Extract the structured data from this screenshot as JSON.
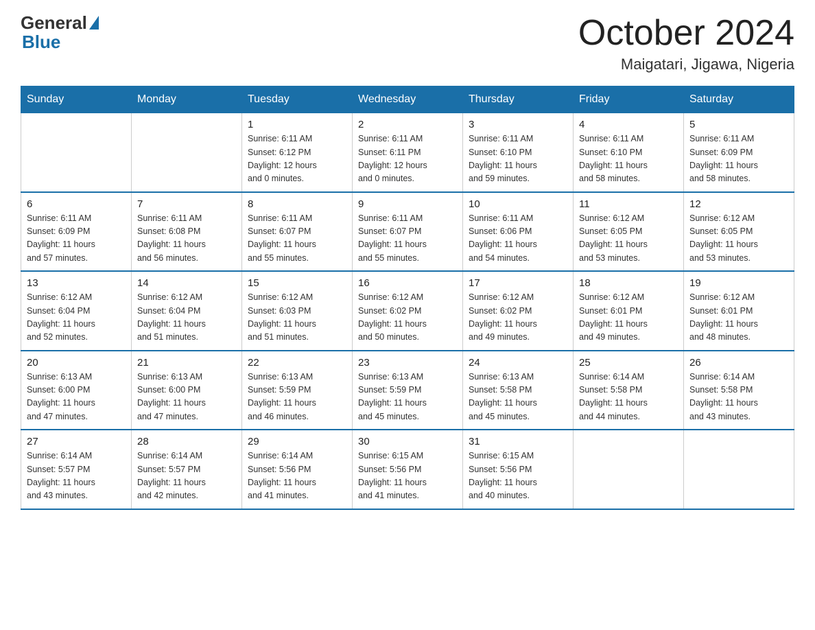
{
  "header": {
    "logo_general": "General",
    "logo_blue": "Blue",
    "title": "October 2024",
    "subtitle": "Maigatari, Jigawa, Nigeria"
  },
  "columns": [
    "Sunday",
    "Monday",
    "Tuesday",
    "Wednesday",
    "Thursday",
    "Friday",
    "Saturday"
  ],
  "weeks": [
    [
      {
        "day": "",
        "info": ""
      },
      {
        "day": "",
        "info": ""
      },
      {
        "day": "1",
        "info": "Sunrise: 6:11 AM\nSunset: 6:12 PM\nDaylight: 12 hours\nand 0 minutes."
      },
      {
        "day": "2",
        "info": "Sunrise: 6:11 AM\nSunset: 6:11 PM\nDaylight: 12 hours\nand 0 minutes."
      },
      {
        "day": "3",
        "info": "Sunrise: 6:11 AM\nSunset: 6:10 PM\nDaylight: 11 hours\nand 59 minutes."
      },
      {
        "day": "4",
        "info": "Sunrise: 6:11 AM\nSunset: 6:10 PM\nDaylight: 11 hours\nand 58 minutes."
      },
      {
        "day": "5",
        "info": "Sunrise: 6:11 AM\nSunset: 6:09 PM\nDaylight: 11 hours\nand 58 minutes."
      }
    ],
    [
      {
        "day": "6",
        "info": "Sunrise: 6:11 AM\nSunset: 6:09 PM\nDaylight: 11 hours\nand 57 minutes."
      },
      {
        "day": "7",
        "info": "Sunrise: 6:11 AM\nSunset: 6:08 PM\nDaylight: 11 hours\nand 56 minutes."
      },
      {
        "day": "8",
        "info": "Sunrise: 6:11 AM\nSunset: 6:07 PM\nDaylight: 11 hours\nand 55 minutes."
      },
      {
        "day": "9",
        "info": "Sunrise: 6:11 AM\nSunset: 6:07 PM\nDaylight: 11 hours\nand 55 minutes."
      },
      {
        "day": "10",
        "info": "Sunrise: 6:11 AM\nSunset: 6:06 PM\nDaylight: 11 hours\nand 54 minutes."
      },
      {
        "day": "11",
        "info": "Sunrise: 6:12 AM\nSunset: 6:05 PM\nDaylight: 11 hours\nand 53 minutes."
      },
      {
        "day": "12",
        "info": "Sunrise: 6:12 AM\nSunset: 6:05 PM\nDaylight: 11 hours\nand 53 minutes."
      }
    ],
    [
      {
        "day": "13",
        "info": "Sunrise: 6:12 AM\nSunset: 6:04 PM\nDaylight: 11 hours\nand 52 minutes."
      },
      {
        "day": "14",
        "info": "Sunrise: 6:12 AM\nSunset: 6:04 PM\nDaylight: 11 hours\nand 51 minutes."
      },
      {
        "day": "15",
        "info": "Sunrise: 6:12 AM\nSunset: 6:03 PM\nDaylight: 11 hours\nand 51 minutes."
      },
      {
        "day": "16",
        "info": "Sunrise: 6:12 AM\nSunset: 6:02 PM\nDaylight: 11 hours\nand 50 minutes."
      },
      {
        "day": "17",
        "info": "Sunrise: 6:12 AM\nSunset: 6:02 PM\nDaylight: 11 hours\nand 49 minutes."
      },
      {
        "day": "18",
        "info": "Sunrise: 6:12 AM\nSunset: 6:01 PM\nDaylight: 11 hours\nand 49 minutes."
      },
      {
        "day": "19",
        "info": "Sunrise: 6:12 AM\nSunset: 6:01 PM\nDaylight: 11 hours\nand 48 minutes."
      }
    ],
    [
      {
        "day": "20",
        "info": "Sunrise: 6:13 AM\nSunset: 6:00 PM\nDaylight: 11 hours\nand 47 minutes."
      },
      {
        "day": "21",
        "info": "Sunrise: 6:13 AM\nSunset: 6:00 PM\nDaylight: 11 hours\nand 47 minutes."
      },
      {
        "day": "22",
        "info": "Sunrise: 6:13 AM\nSunset: 5:59 PM\nDaylight: 11 hours\nand 46 minutes."
      },
      {
        "day": "23",
        "info": "Sunrise: 6:13 AM\nSunset: 5:59 PM\nDaylight: 11 hours\nand 45 minutes."
      },
      {
        "day": "24",
        "info": "Sunrise: 6:13 AM\nSunset: 5:58 PM\nDaylight: 11 hours\nand 45 minutes."
      },
      {
        "day": "25",
        "info": "Sunrise: 6:14 AM\nSunset: 5:58 PM\nDaylight: 11 hours\nand 44 minutes."
      },
      {
        "day": "26",
        "info": "Sunrise: 6:14 AM\nSunset: 5:58 PM\nDaylight: 11 hours\nand 43 minutes."
      }
    ],
    [
      {
        "day": "27",
        "info": "Sunrise: 6:14 AM\nSunset: 5:57 PM\nDaylight: 11 hours\nand 43 minutes."
      },
      {
        "day": "28",
        "info": "Sunrise: 6:14 AM\nSunset: 5:57 PM\nDaylight: 11 hours\nand 42 minutes."
      },
      {
        "day": "29",
        "info": "Sunrise: 6:14 AM\nSunset: 5:56 PM\nDaylight: 11 hours\nand 41 minutes."
      },
      {
        "day": "30",
        "info": "Sunrise: 6:15 AM\nSunset: 5:56 PM\nDaylight: 11 hours\nand 41 minutes."
      },
      {
        "day": "31",
        "info": "Sunrise: 6:15 AM\nSunset: 5:56 PM\nDaylight: 11 hours\nand 40 minutes."
      },
      {
        "day": "",
        "info": ""
      },
      {
        "day": "",
        "info": ""
      }
    ]
  ]
}
